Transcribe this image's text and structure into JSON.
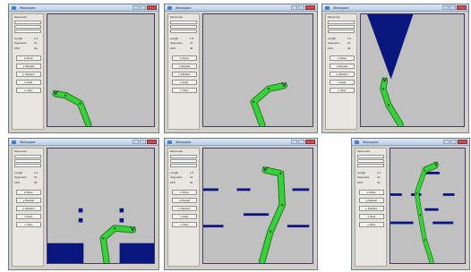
{
  "window": {
    "title": "Workspace",
    "close_glyph": "x"
  },
  "panel": {
    "header": "Movement",
    "length_label": "Length",
    "segments_label": "Segments",
    "segments_value": "10",
    "length_value": "1.5",
    "fps_label": "FPS",
    "fps_value": "30",
    "buttons": [
      "Move",
      "Repeat",
      "Solution",
      "Help",
      "Stop"
    ]
  },
  "colors": {
    "arm": "#39d13a",
    "obstacle": "#0a157e",
    "canvas": "#c0c0c0",
    "panel": "#d4d0c8"
  },
  "icons": [
    "app-icon",
    "minimize-icon",
    "maximize-icon",
    "close-icon",
    "play-icon",
    "repeat-icon",
    "solution-icon",
    "help-icon",
    "stop-icon"
  ]
}
